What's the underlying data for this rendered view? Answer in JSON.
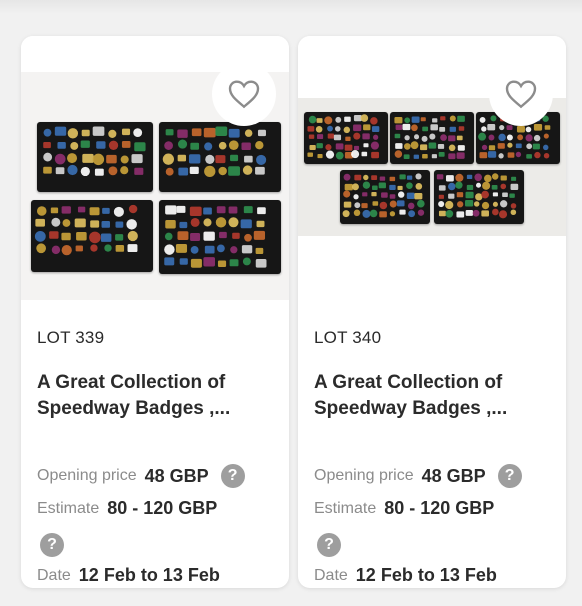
{
  "lots": [
    {
      "lot": "LOT 339",
      "title_line1": "A Great Collection of",
      "title_line2": "Speedway Badges ,...",
      "opening_label": "Opening price",
      "opening_value": "48 GBP",
      "estimate_label": "Estimate",
      "estimate_value": "80 - 120 GBP",
      "date_label": "Date",
      "date_value": "12 Feb to 13 Feb",
      "help_icon": "?",
      "favorite_icon": "heart-outline"
    },
    {
      "lot": "LOT 340",
      "title_line1": "A Great Collection of",
      "title_line2": "Speedway Badges ,...",
      "opening_label": "Opening price",
      "opening_value": "48 GBP",
      "estimate_label": "Estimate",
      "estimate_value": "80 - 120 GBP",
      "date_label": "Date",
      "date_value": "12 Feb to 13 Feb",
      "help_icon": "?",
      "favorite_icon": "heart-outline"
    }
  ],
  "colors": {
    "page_bg": "#f1f1f1",
    "card_bg": "#ffffff",
    "tray": "#161616",
    "help_icon_bg": "#9e9e9e"
  }
}
